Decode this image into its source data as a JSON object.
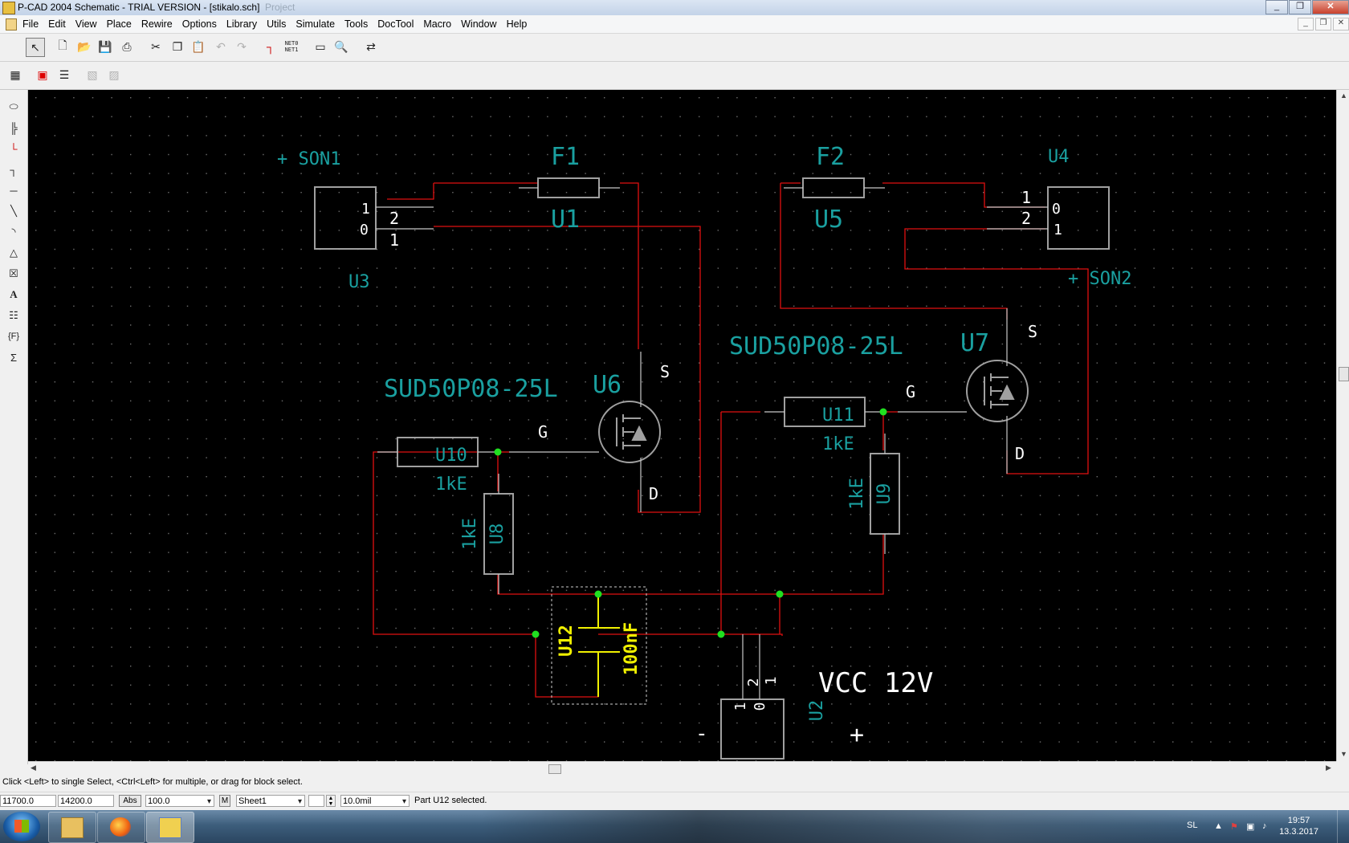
{
  "window": {
    "title": "P-CAD 2004 Schematic - TRIAL VERSION  - [stikalo.sch]",
    "ghost_title": "Project",
    "controls": [
      "_",
      "❐",
      "✕"
    ]
  },
  "menu": [
    "File",
    "Edit",
    "View",
    "Place",
    "Rewire",
    "Options",
    "Library",
    "Utils",
    "Simulate",
    "Tools",
    "DocTool",
    "Macro",
    "Window",
    "Help"
  ],
  "toolbar": {
    "net_label_top": "NET0",
    "net_label_bottom": "NET1"
  },
  "schematic": {
    "labels": {
      "son1": "+ SON1",
      "son2": "+ SON2",
      "f1": "F1",
      "f2": "F2",
      "u1": "U1",
      "u5": "U5",
      "u3": "U3",
      "u4": "U4",
      "u6_val": "SUD50P08-25L",
      "u6": "U6",
      "u7_val": "SUD50P08-25L",
      "u7": "U7",
      "u10": "U10",
      "u11": "U11",
      "u10_val": "1kE",
      "u11_val": "1kE",
      "u8": "U8",
      "u9": "U9",
      "u8_val": "1kE",
      "u9_val": "1kE",
      "u12": "U12",
      "u12_val": "100nF",
      "u2": "U2",
      "vcc": "VCC 12V",
      "minus": "-",
      "plus": "+",
      "pin_s": "S",
      "pin_g": "G",
      "pin_d": "D",
      "p1": "1",
      "p2": "2",
      "p0": "0"
    },
    "colors": {
      "background": "#000000",
      "wire": "#e01010",
      "component": "#a0a0a0",
      "label": "#1aa0a0",
      "selected": "#ffff00",
      "junction": "#20e020",
      "pin_text": "#ffffff"
    }
  },
  "status": {
    "message": "Click <Left> to single Select, <Ctrl<Left> for multiple, or drag for block select.",
    "x": "11700.0",
    "y": "14200.0",
    "abs": "Abs",
    "zoom": "100.0",
    "m": "M",
    "sheet": "Sheet1",
    "grid": "10.0mil",
    "info": "Part U12 selected."
  },
  "taskbar": {
    "lang": "SL",
    "time": "19:57",
    "date": "13.3.2017"
  }
}
